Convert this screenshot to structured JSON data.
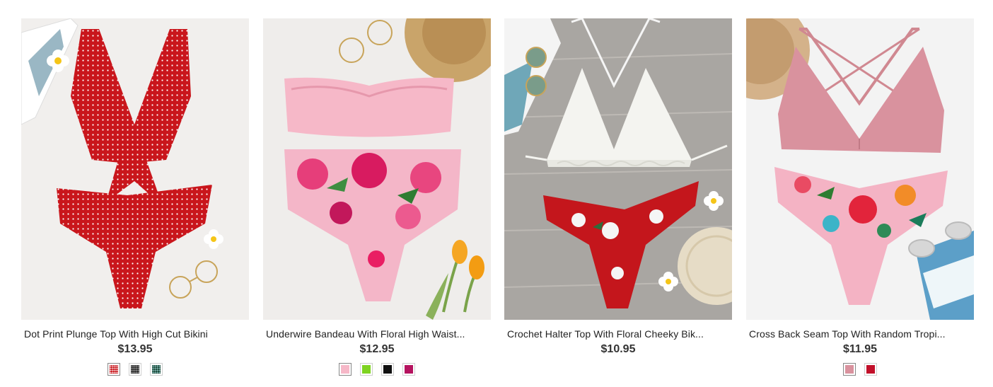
{
  "products": [
    {
      "title": "Dot Print Plunge Top With High Cut Bikini",
      "price": "$13.95",
      "swatches": [
        {
          "color": "#c9161c",
          "pattern": "dot"
        },
        {
          "color": "#2b2b2b",
          "pattern": "dot"
        },
        {
          "color": "#1d4d3c",
          "pattern": "dot"
        }
      ]
    },
    {
      "title": "Underwire Bandeau With Floral High Waist...",
      "price": "$12.95",
      "swatches": [
        {
          "color": "#f6b8c8",
          "pattern": "solid"
        },
        {
          "color": "#7ed321",
          "pattern": "solid"
        },
        {
          "color": "#111111",
          "pattern": "solid"
        },
        {
          "color": "#b5135f",
          "pattern": "solid"
        }
      ]
    },
    {
      "title": "Crochet Halter Top With Floral Cheeky Bik...",
      "price": "$10.95",
      "swatches": []
    },
    {
      "title": "Cross Back Seam Top With Random Tropi...",
      "price": "$11.95",
      "swatches": [
        {
          "color": "#d9929e",
          "pattern": "solid"
        },
        {
          "color": "#c2102a",
          "pattern": "solid"
        }
      ]
    }
  ]
}
